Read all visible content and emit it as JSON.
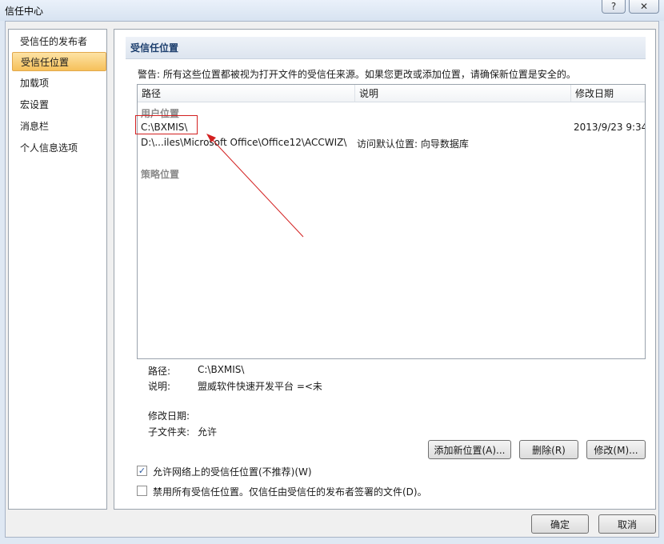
{
  "window": {
    "title": "信任中心",
    "help_label": "?",
    "close_label": "✕"
  },
  "sidebar": {
    "items": [
      {
        "label": "受信任的发布者"
      },
      {
        "label": "受信任位置"
      },
      {
        "label": "加载项"
      },
      {
        "label": "宏设置"
      },
      {
        "label": "消息栏"
      },
      {
        "label": "个人信息选项"
      }
    ],
    "selected_index": 1
  },
  "main": {
    "section_title": "受信任位置",
    "warning": "警告: 所有这些位置都被视为打开文件的受信任来源。如果您更改或添加位置，请确保新位置是安全的。",
    "columns": [
      "路径",
      "说明",
      "修改日期"
    ],
    "groups": {
      "user": "用户位置",
      "policy": "策略位置"
    },
    "rows": [
      {
        "path": "C:\\BXMIS\\",
        "description": "",
        "modified": "2013/9/23 9:34"
      },
      {
        "path": "D:\\...iles\\Microsoft Office\\Office12\\ACCWIZ\\",
        "description": "访问默认位置: 向导数据库",
        "modified": ""
      }
    ]
  },
  "details": {
    "path_label": "路径:",
    "path_value": "C:\\BXMIS\\",
    "desc_label": "说明:",
    "desc_value": "盟威软件快速开发平台 =<未",
    "modified_label": "修改日期:",
    "modified_value": "",
    "subfolder_label": "子文件夹:",
    "subfolder_value": "允许"
  },
  "buttons": {
    "add": "添加新位置(A)...",
    "remove": "删除(R)",
    "modify": "修改(M)...",
    "ok": "确定",
    "cancel": "取消"
  },
  "options": {
    "allow_network": {
      "label": "允许网络上的受信任位置(不推荐)(W)",
      "checked": true
    },
    "disable_all": {
      "label": "禁用所有受信任位置。仅信任由受信任的发布者签署的文件(D)。",
      "checked": false
    }
  },
  "colors": {
    "annotation": "#d32020",
    "selection": "#f6c05a",
    "header_text": "#1d3f6e"
  }
}
